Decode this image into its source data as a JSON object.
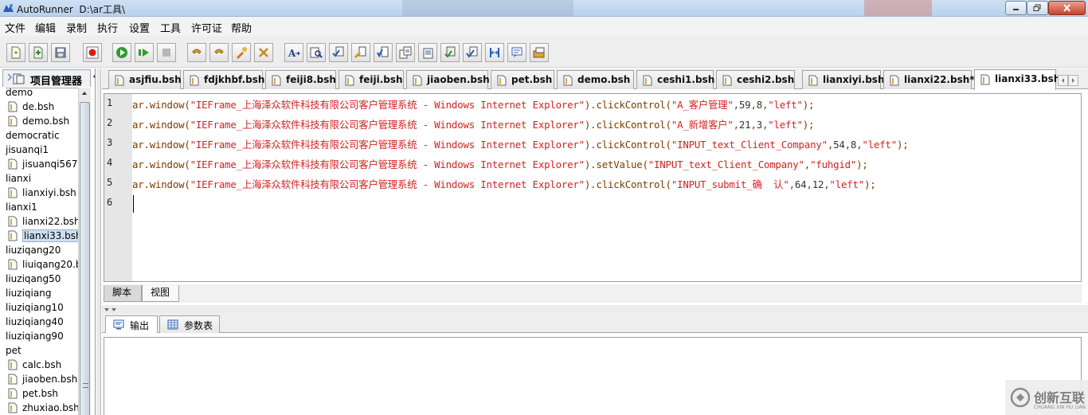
{
  "window": {
    "title": "AutoRunner  D:\\ar工具\\"
  },
  "menu": [
    "文件",
    "编辑",
    "录制",
    "执行",
    "设置",
    "工具",
    "许可证",
    "帮助"
  ],
  "toolbar": {
    "buttons": [
      {
        "name": "new-script-icon"
      },
      {
        "name": "open-script-icon"
      },
      {
        "name": "save-icon"
      },
      {
        "name": "record-icon"
      },
      {
        "name": "run-icon"
      },
      {
        "name": "run-step-icon"
      },
      {
        "name": "stop-icon"
      },
      {
        "name": "undo-icon"
      },
      {
        "name": "redo-icon"
      },
      {
        "name": "tool-icon"
      },
      {
        "name": "tools-settings-icon"
      },
      {
        "name": "text-format-icon"
      },
      {
        "name": "find-icon"
      },
      {
        "name": "check-point-icon"
      },
      {
        "name": "insert-icon"
      },
      {
        "name": "verify-icon"
      },
      {
        "name": "copy-icon"
      },
      {
        "name": "paste-icon"
      },
      {
        "name": "object-icon"
      },
      {
        "name": "verify-object-icon"
      },
      {
        "name": "split-icon"
      },
      {
        "name": "comment-icon"
      },
      {
        "name": "toolbox-icon"
      }
    ]
  },
  "project_manager": {
    "title": "项目管理器",
    "items": [
      {
        "label": "demo",
        "type": "folder"
      },
      {
        "label": "de.bsh",
        "type": "file"
      },
      {
        "label": "demo.bsh",
        "type": "file"
      },
      {
        "label": "democratic",
        "type": "folder"
      },
      {
        "label": "jisuanqi1",
        "type": "folder"
      },
      {
        "label": "jisuanqi567.",
        "type": "file"
      },
      {
        "label": "lianxi",
        "type": "folder"
      },
      {
        "label": "lianxiyi.bsh",
        "type": "file"
      },
      {
        "label": "lianxi1",
        "type": "folder"
      },
      {
        "label": "lianxi22.bsh",
        "type": "file"
      },
      {
        "label": "lianxi33.bsh",
        "type": "file",
        "selected": true
      },
      {
        "label": "liuziqang20",
        "type": "folder"
      },
      {
        "label": "liuiqang20.b",
        "type": "file"
      },
      {
        "label": "liuziqang50",
        "type": "folder"
      },
      {
        "label": "liuziqiang",
        "type": "folder"
      },
      {
        "label": "liuziqiang10",
        "type": "folder"
      },
      {
        "label": "liuziqiang40",
        "type": "folder"
      },
      {
        "label": "liuziqiang90",
        "type": "folder"
      },
      {
        "label": "pet",
        "type": "folder"
      },
      {
        "label": "calc.bsh",
        "type": "file"
      },
      {
        "label": "jiaoben.bsh",
        "type": "file"
      },
      {
        "label": "pet.bsh",
        "type": "file"
      },
      {
        "label": "zhuxiao.bsh",
        "type": "file"
      }
    ]
  },
  "editor_tabs": [
    {
      "label": "asjfiu.bsh"
    },
    {
      "label": "fdjkhbf.bsh"
    },
    {
      "label": "feiji8.bsh"
    },
    {
      "label": "feiji.bsh"
    },
    {
      "label": "jiaoben.bsh"
    },
    {
      "label": "pet.bsh"
    },
    {
      "label": "demo.bsh"
    },
    {
      "label": "ceshi1.bsh"
    },
    {
      "label": "ceshi2.bsh"
    },
    {
      "label": "lianxiyi.bsh"
    },
    {
      "label": "lianxi22.bsh*"
    },
    {
      "label": "lianxi33.bsh",
      "active": true
    }
  ],
  "code_lines": [
    {
      "n": "1",
      "pre": "ar.window(",
      "win": "\"IEFrame_上海泽众软件科技有限公司客户管理系统 - Windows Internet Explorer\"",
      "mid": ").clickControl(",
      "args": [
        {
          "t": "s",
          "v": "\"A_客户管理\""
        },
        {
          "t": "p",
          "v": ","
        },
        {
          "t": "n",
          "v": "59"
        },
        {
          "t": "p",
          "v": ","
        },
        {
          "t": "n",
          "v": "8"
        },
        {
          "t": "p",
          "v": ","
        },
        {
          "t": "s",
          "v": "\"left\""
        },
        {
          "t": "p",
          "v": ");"
        }
      ]
    },
    {
      "n": "2",
      "pre": "ar.window(",
      "win": "\"IEFrame_上海泽众软件科技有限公司客户管理系统 - Windows Internet Explorer\"",
      "mid": ").clickControl(",
      "args": [
        {
          "t": "s",
          "v": "\"A_新增客户\""
        },
        {
          "t": "p",
          "v": ","
        },
        {
          "t": "n",
          "v": "21"
        },
        {
          "t": "p",
          "v": ","
        },
        {
          "t": "n",
          "v": "3"
        },
        {
          "t": "p",
          "v": ","
        },
        {
          "t": "s",
          "v": "\"left\""
        },
        {
          "t": "p",
          "v": ");"
        }
      ]
    },
    {
      "n": "3",
      "pre": "ar.window(",
      "win": "\"IEFrame_上海泽众软件科技有限公司客户管理系统 - Windows Internet Explorer\"",
      "mid": ").clickControl(",
      "args": [
        {
          "t": "s",
          "v": "\"INPUT_text_Client_Company\""
        },
        {
          "t": "p",
          "v": ","
        },
        {
          "t": "n",
          "v": "54"
        },
        {
          "t": "p",
          "v": ","
        },
        {
          "t": "n",
          "v": "8"
        },
        {
          "t": "p",
          "v": ","
        },
        {
          "t": "s",
          "v": "\"left\""
        },
        {
          "t": "p",
          "v": ");"
        }
      ]
    },
    {
      "n": "4",
      "pre": "ar.window(",
      "win": "\"IEFrame_上海泽众软件科技有限公司客户管理系统 - Windows Internet Explorer\"",
      "mid": ").setValue(",
      "args": [
        {
          "t": "s",
          "v": "\"INPUT_text_Client_Company\""
        },
        {
          "t": "p",
          "v": ","
        },
        {
          "t": "s",
          "v": "\"fuhgid\""
        },
        {
          "t": "p",
          "v": ");"
        }
      ]
    },
    {
      "n": "5",
      "pre": "ar.window(",
      "win": "\"IEFrame_上海泽众软件科技有限公司客户管理系统 - Windows Internet Explorer\"",
      "mid": ").clickControl(",
      "args": [
        {
          "t": "s",
          "v": "\"INPUT_submit_确  认\""
        },
        {
          "t": "p",
          "v": ","
        },
        {
          "t": "n",
          "v": "64"
        },
        {
          "t": "p",
          "v": ","
        },
        {
          "t": "n",
          "v": "12"
        },
        {
          "t": "p",
          "v": ","
        },
        {
          "t": "s",
          "v": "\"left\""
        },
        {
          "t": "p",
          "v": ");"
        }
      ]
    },
    {
      "n": "6",
      "pre": "",
      "win": "",
      "mid": "",
      "args": []
    }
  ],
  "editor_view_tabs": {
    "script": "脚本",
    "view": "视图"
  },
  "output_tabs": {
    "output": "输出",
    "params": "参数表"
  },
  "watermark": {
    "text": "创新互联",
    "sub": "CHUANG XIN HU LIAN"
  },
  "colors": {
    "code_string": "#d42222",
    "code_ident": "#7a3b00",
    "selection": "#cfdff3"
  }
}
